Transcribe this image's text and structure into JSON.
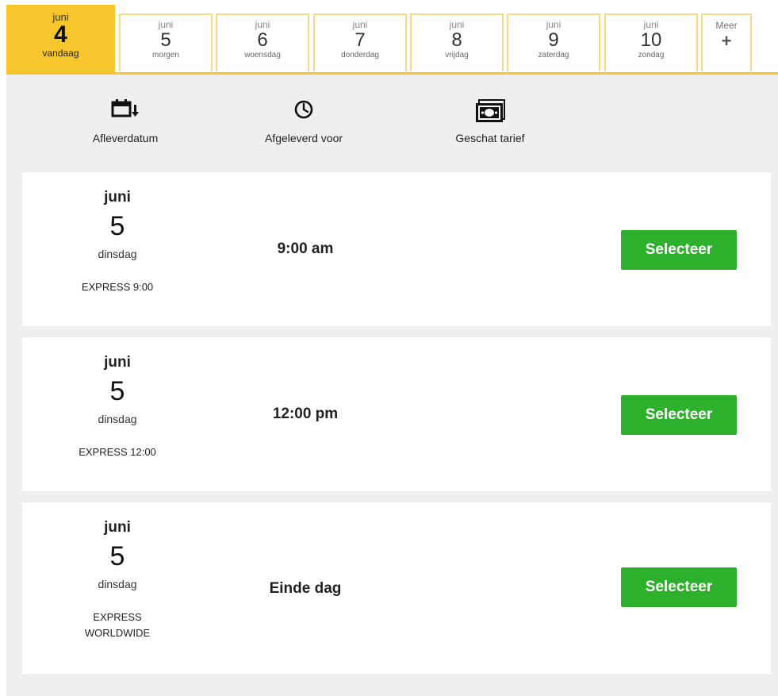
{
  "tabs": [
    {
      "month": "juni",
      "day": "4",
      "label": "vandaag",
      "active": true
    },
    {
      "month": "juni",
      "day": "5",
      "label": "morgen"
    },
    {
      "month": "juni",
      "day": "6",
      "label": "woensdag"
    },
    {
      "month": "juni",
      "day": "7",
      "label": "donderdag"
    },
    {
      "month": "juni",
      "day": "8",
      "label": "vrijdag"
    },
    {
      "month": "juni",
      "day": "9",
      "label": "zaterdag"
    },
    {
      "month": "juni",
      "day": "10",
      "label": "zondag"
    }
  ],
  "more": {
    "label": "Meer",
    "icon": "plus-icon",
    "symbol": "+"
  },
  "sort": {
    "delivery_date": {
      "label": "Afleverdatum",
      "icon": "calendar-sort-icon"
    },
    "delivered_by": {
      "label": "Afgeleverd voor",
      "icon": "clock-icon"
    },
    "estimated_rate": {
      "label": "Geschat tarief",
      "icon": "money-icon"
    }
  },
  "options": [
    {
      "month": "juni",
      "day": "5",
      "weekday": "dinsdag",
      "service": "EXPRESS 9:00",
      "time": "9:00 am",
      "button": "Selecteer"
    },
    {
      "month": "juni",
      "day": "5",
      "weekday": "dinsdag",
      "service": "EXPRESS 12:00",
      "time": "12:00 pm",
      "button": "Selecteer"
    },
    {
      "month": "juni",
      "day": "5",
      "weekday": "dinsdag",
      "service": "EXPRESS\nWORLDWIDE",
      "time": "Einde dag",
      "button": "Selecteer"
    }
  ],
  "colors": {
    "accent": "#f7c52c",
    "button": "#2db12d",
    "panel": "#efefef"
  }
}
